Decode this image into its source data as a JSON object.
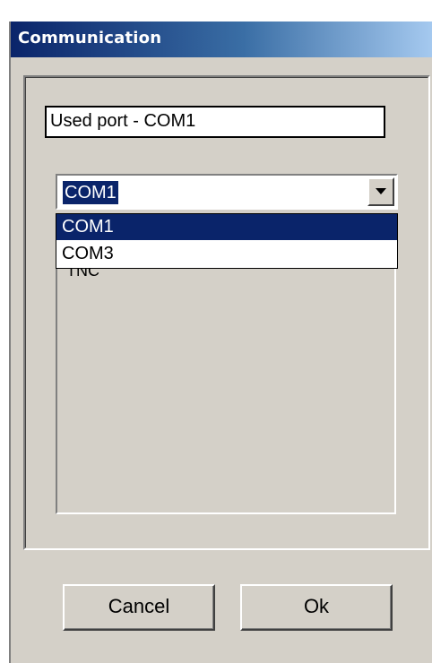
{
  "window": {
    "title": "Communication"
  },
  "used_port_field": {
    "value": "Used port - COM1"
  },
  "port_select": {
    "selected_value": "COM1",
    "options": [
      "COM1",
      "COM3"
    ],
    "highlighted_option": "COM1"
  },
  "listbox": {
    "partial_item": "TNC"
  },
  "buttons": {
    "cancel_label": "Cancel",
    "ok_label": "Ok"
  },
  "colors": {
    "titlebar_start": "#0a246a",
    "titlebar_end": "#a6caf0",
    "selection": "#0a246a",
    "face": "#d4d0c8"
  },
  "icons": {
    "dropdown_arrow": "chevron-down-icon"
  }
}
